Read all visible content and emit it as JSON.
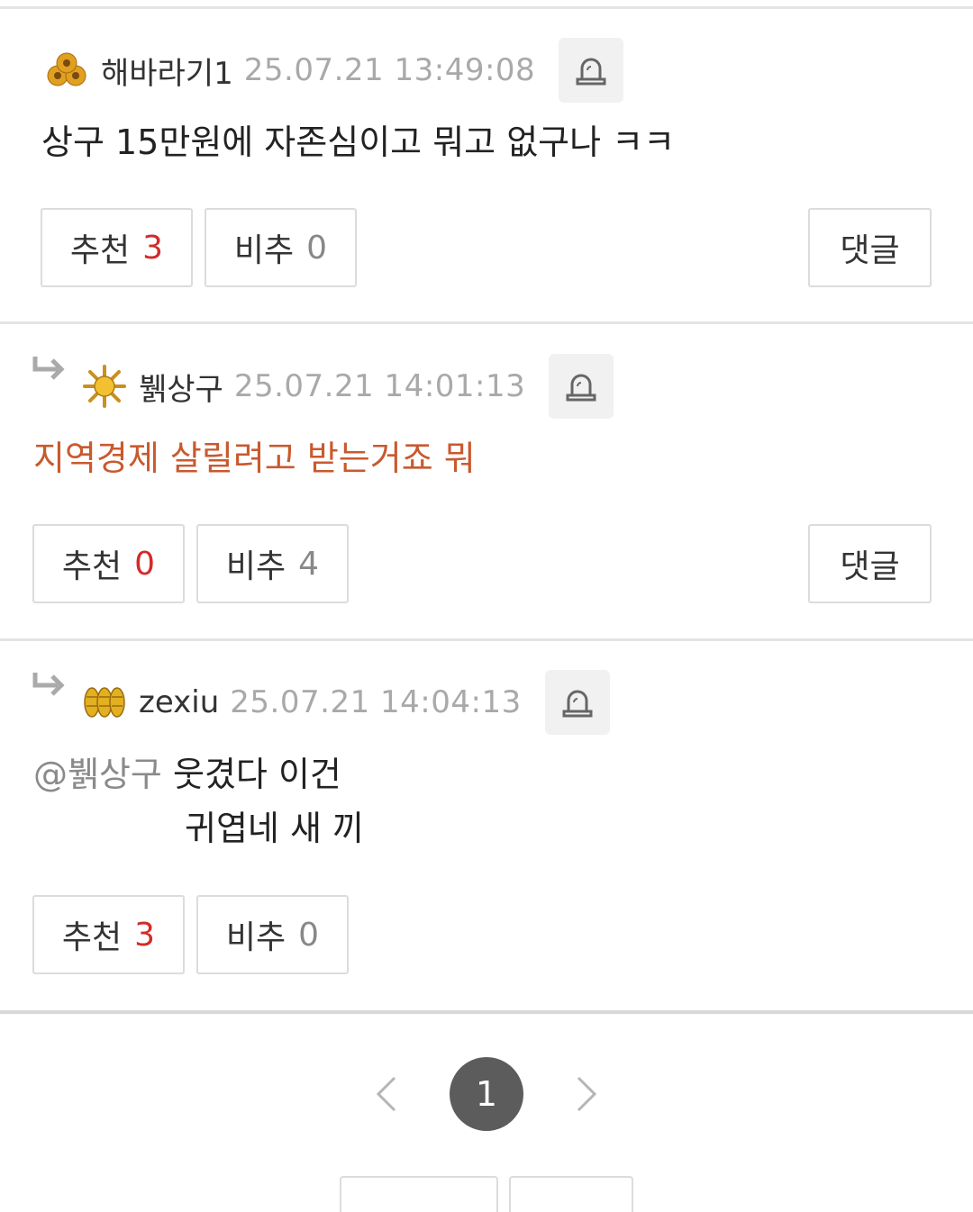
{
  "comments": [
    {
      "nickname": "해바라기1",
      "timestamp": "25.07.21 13:49:08",
      "badge_icon": "sunflower-cluster-icon",
      "text": "상구 15만원에 자존심이고 뭐고 없구나 ㅋㅋ",
      "recommend_label": "추천",
      "recommend_count": "3",
      "disrecommend_label": "비추",
      "disrecommend_count": "0",
      "reply_label": "댓글"
    },
    {
      "nickname": "뷁상구",
      "timestamp": "25.07.21 14:01:13",
      "badge_icon": "sun-flower-icon",
      "text": "지역경제 살릴려고 받는거죠 뭐",
      "recommend_label": "추천",
      "recommend_count": "0",
      "disrecommend_label": "비추",
      "disrecommend_count": "4",
      "reply_label": "댓글"
    },
    {
      "nickname": "zexiu",
      "timestamp": "25.07.21 14:04:13",
      "badge_icon": "wheat-bundle-icon",
      "mention": "@뷁상구",
      "text_line1": "웃겼다 이건",
      "text_line2": "귀엽네 새 끼",
      "recommend_label": "추천",
      "recommend_count": "3",
      "disrecommend_label": "비추",
      "disrecommend_count": "0"
    }
  ],
  "pagination": {
    "current_page": "1"
  },
  "colors": {
    "highlight_text": "#c85a2e",
    "recommend_count": "#d22b2b",
    "timestamp": "#a9a9a9",
    "page_active_bg": "#5c5c5c"
  }
}
